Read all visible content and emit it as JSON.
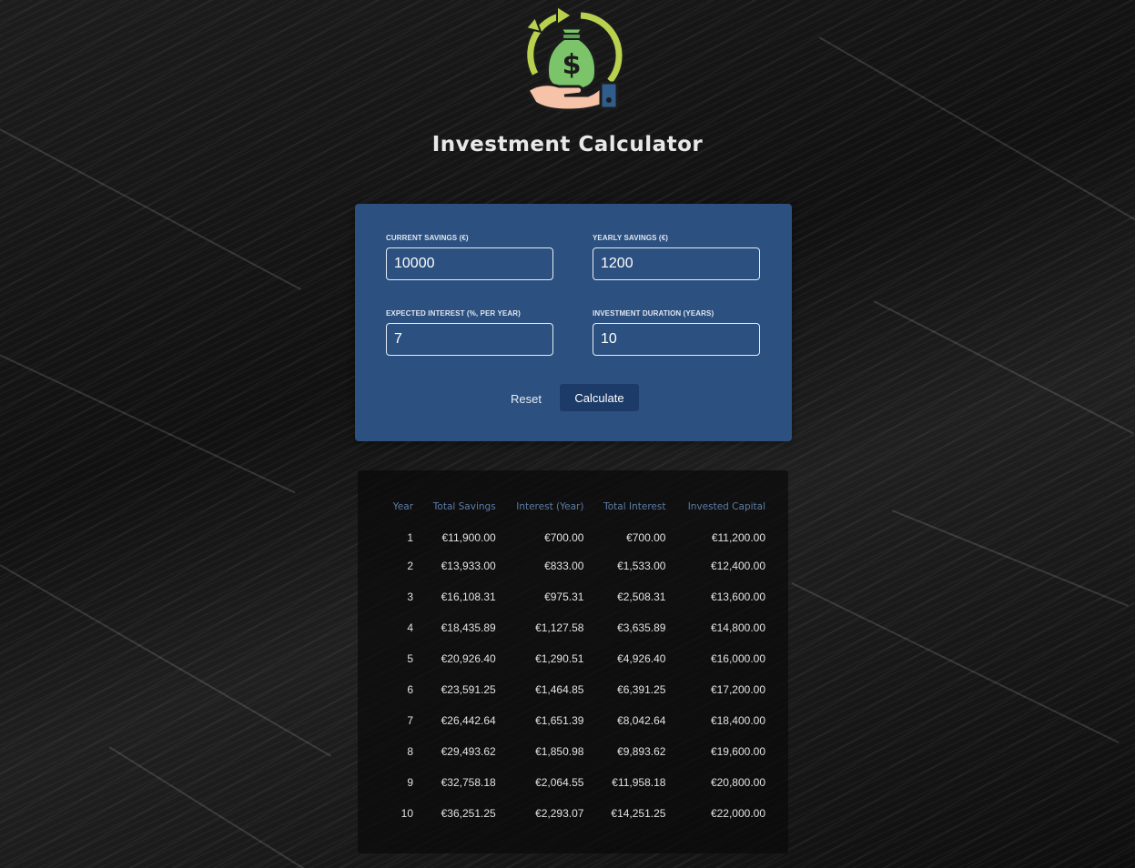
{
  "header": {
    "title": "Investment Calculator",
    "logo_icon": "money-bag-hand-icon"
  },
  "form": {
    "fields": [
      {
        "label": "CURRENT SAVINGS (€)",
        "value": "10000"
      },
      {
        "label": "YEARLY SAVINGS (€)",
        "value": "1200"
      },
      {
        "label": "EXPECTED INTEREST (%, PER YEAR)",
        "value": "7"
      },
      {
        "label": "INVESTMENT DURATION (YEARS)",
        "value": "10"
      }
    ],
    "reset_label": "Reset",
    "calculate_label": "Calculate"
  },
  "results": {
    "columns": [
      "Year",
      "Total Savings",
      "Interest (Year)",
      "Total Interest",
      "Invested Capital"
    ],
    "rows": [
      [
        "1",
        "€11,900.00",
        "€700.00",
        "€700.00",
        "€11,200.00"
      ],
      [
        "2",
        "€13,933.00",
        "€833.00",
        "€1,533.00",
        "€12,400.00"
      ],
      [
        "3",
        "€16,108.31",
        "€975.31",
        "€2,508.31",
        "€13,600.00"
      ],
      [
        "4",
        "€18,435.89",
        "€1,127.58",
        "€3,635.89",
        "€14,800.00"
      ],
      [
        "5",
        "€20,926.40",
        "€1,290.51",
        "€4,926.40",
        "€16,000.00"
      ],
      [
        "6",
        "€23,591.25",
        "€1,464.85",
        "€6,391.25",
        "€17,200.00"
      ],
      [
        "7",
        "€26,442.64",
        "€1,651.39",
        "€8,042.64",
        "€18,400.00"
      ],
      [
        "8",
        "€29,493.62",
        "€1,850.98",
        "€9,893.62",
        "€19,600.00"
      ],
      [
        "9",
        "€32,758.18",
        "€2,064.55",
        "€11,958.18",
        "€20,800.00"
      ],
      [
        "10",
        "€36,251.25",
        "€2,293.07",
        "€14,251.25",
        "€22,000.00"
      ]
    ]
  },
  "colors": {
    "card": "#2c5080",
    "button": "#1c3b68",
    "header_text": "#5e7ba4"
  }
}
